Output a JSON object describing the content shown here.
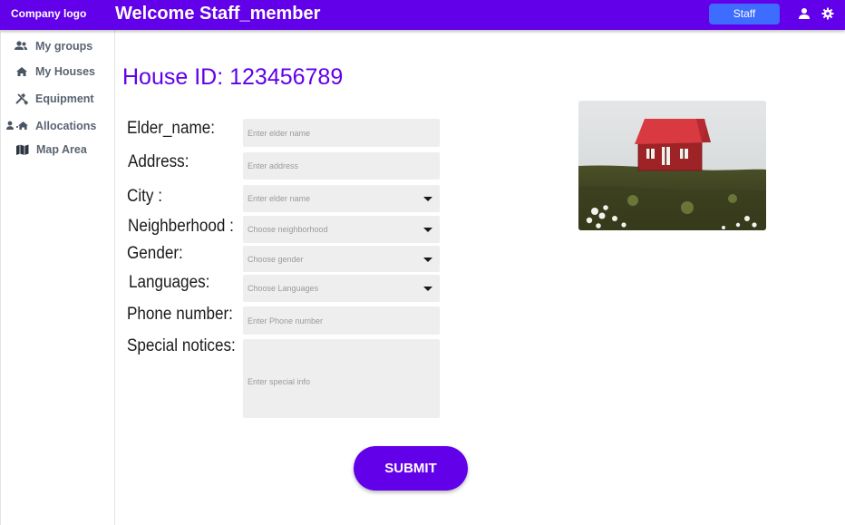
{
  "topbar": {
    "logo": "Company logo",
    "welcome": "Welcome Staff_member",
    "role_button": "Staff",
    "icons": [
      "user-icon",
      "gear-icon"
    ],
    "accent_color": "#6200ea"
  },
  "sidebar": {
    "items": [
      {
        "label": "My groups",
        "icon": "groups-icon"
      },
      {
        "label": "My Houses",
        "icon": "house-icon"
      },
      {
        "label": "Equipment",
        "icon": "tools-icon"
      },
      {
        "label": "Allocations",
        "icon": "allocations-icon"
      },
      {
        "label": "Map Area",
        "icon": "map-icon"
      }
    ]
  },
  "page": {
    "title": "House ID: 123456789"
  },
  "form": {
    "fields": [
      {
        "label": "Elder_name:",
        "placeholder": "Enter elder name",
        "type": "text"
      },
      {
        "label": "Address:",
        "placeholder": "Enter address",
        "type": "text"
      },
      {
        "label": "City :",
        "placeholder": "Enter elder name",
        "type": "select"
      },
      {
        "label": "Neighberhood :",
        "placeholder": "Choose neighborhood",
        "type": "select"
      },
      {
        "label": "Gender:",
        "placeholder": "Choose gender",
        "type": "select"
      },
      {
        "label": "Languages:",
        "placeholder": "Choose Languages",
        "type": "select"
      },
      {
        "label": "Phone number:",
        "placeholder": "Enter Phone number",
        "type": "text"
      },
      {
        "label": "Special notices:",
        "placeholder": "Enter special info",
        "type": "textarea"
      }
    ],
    "submit_label": "SUBMIT"
  },
  "image": {
    "subject": "house-photo"
  }
}
